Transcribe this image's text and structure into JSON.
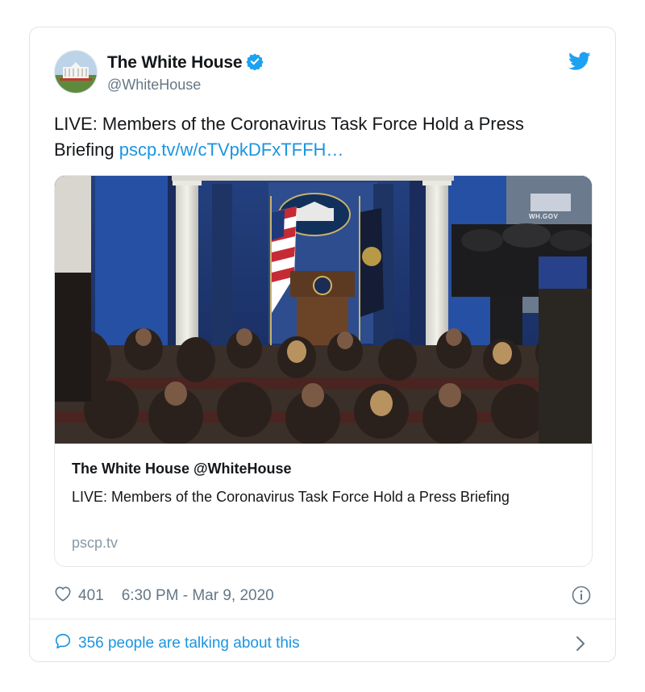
{
  "tweet": {
    "author_name": "The White House",
    "handle": "@WhiteHouse",
    "text": "LIVE: Members of the Coronavirus Task Force Hold a Press Briefing",
    "link_text": "pscp.tv/w/cTVpkDFxTFFH…",
    "likes": "401",
    "timestamp": "6:30 PM - Mar 9, 2020",
    "talking": "356 people are talking about this"
  },
  "card": {
    "title": "The White House @WhiteHouse",
    "description": "LIVE: Members of the Coronavirus Task Force Hold a Press Briefing",
    "domain": "pscp.tv"
  },
  "media": {
    "watermark": "WH.GOV"
  },
  "colors": {
    "link": "#1b95e0",
    "secondary_text": "#657786",
    "verified": "#1da1f2",
    "twitter_bird": "#1da1f2"
  },
  "icons": {
    "verified": "verified-badge-icon",
    "bird": "twitter-bird-icon",
    "heart": "heart-icon",
    "info": "info-icon",
    "reply": "speech-bubble-icon",
    "chevron": "chevron-right-icon"
  }
}
